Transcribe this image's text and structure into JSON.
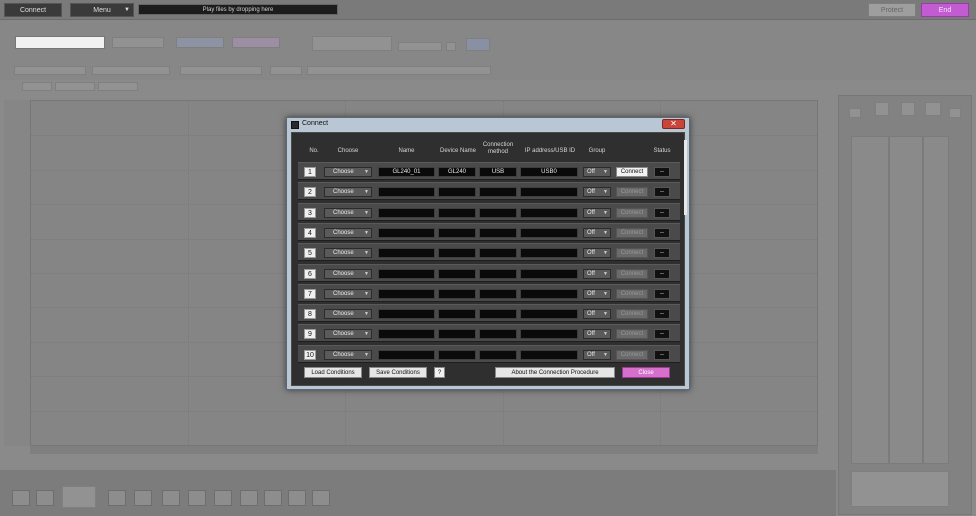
{
  "toolbar": {
    "connect_label": "Connect",
    "menu_label": "Menu",
    "play_files_label": "Play files by dropping here",
    "protect_label": "Protect",
    "end_label": "End"
  },
  "dialog": {
    "title": "Connect",
    "close_icon_glyph": "✕",
    "headers": {
      "no": "No.",
      "choose": "Choose",
      "name": "Name",
      "device_name": "Device Name",
      "connection_method": "Connection method",
      "ip_usb_id": "IP address/USB ID",
      "group": "Group",
      "status": "Status"
    },
    "rows": [
      {
        "no": "1",
        "choose": "Choose",
        "name": "GL240_01",
        "device": "GL240",
        "method": "USB",
        "ip": "USB0",
        "group": "Off",
        "connect": "Connect",
        "status": "--"
      },
      {
        "no": "2",
        "choose": "Choose",
        "name": "",
        "device": "",
        "method": "",
        "ip": "",
        "group": "Off",
        "connect": "Connect",
        "status": "--"
      },
      {
        "no": "3",
        "choose": "Choose",
        "name": "",
        "device": "",
        "method": "",
        "ip": "",
        "group": "Off",
        "connect": "Connect",
        "status": "--"
      },
      {
        "no": "4",
        "choose": "Choose",
        "name": "",
        "device": "",
        "method": "",
        "ip": "",
        "group": "Off",
        "connect": "Connect",
        "status": "--"
      },
      {
        "no": "5",
        "choose": "Choose",
        "name": "",
        "device": "",
        "method": "",
        "ip": "",
        "group": "Off",
        "connect": "Connect",
        "status": "--"
      },
      {
        "no": "6",
        "choose": "Choose",
        "name": "",
        "device": "",
        "method": "",
        "ip": "",
        "group": "Off",
        "connect": "Connect",
        "status": "--"
      },
      {
        "no": "7",
        "choose": "Choose",
        "name": "",
        "device": "",
        "method": "",
        "ip": "",
        "group": "Off",
        "connect": "Connect",
        "status": "--"
      },
      {
        "no": "8",
        "choose": "Choose",
        "name": "",
        "device": "",
        "method": "",
        "ip": "",
        "group": "Off",
        "connect": "Connect",
        "status": "--"
      },
      {
        "no": "9",
        "choose": "Choose",
        "name": "",
        "device": "",
        "method": "",
        "ip": "",
        "group": "Off",
        "connect": "Connect",
        "status": "--"
      },
      {
        "no": "10",
        "choose": "Choose",
        "name": "",
        "device": "",
        "method": "",
        "ip": "",
        "group": "Off",
        "connect": "Connect",
        "status": "--"
      }
    ],
    "footer": {
      "load_conditions": "Load Conditions",
      "save_conditions": "Save Conditions",
      "help": "?",
      "about": "About the Connection Procedure",
      "close": "Close"
    }
  },
  "colors": {
    "end_button": "#c35bd3",
    "close_button": "#d770cc",
    "dialog_frame": "#b9c6d3",
    "title_close": "#c9443a"
  }
}
